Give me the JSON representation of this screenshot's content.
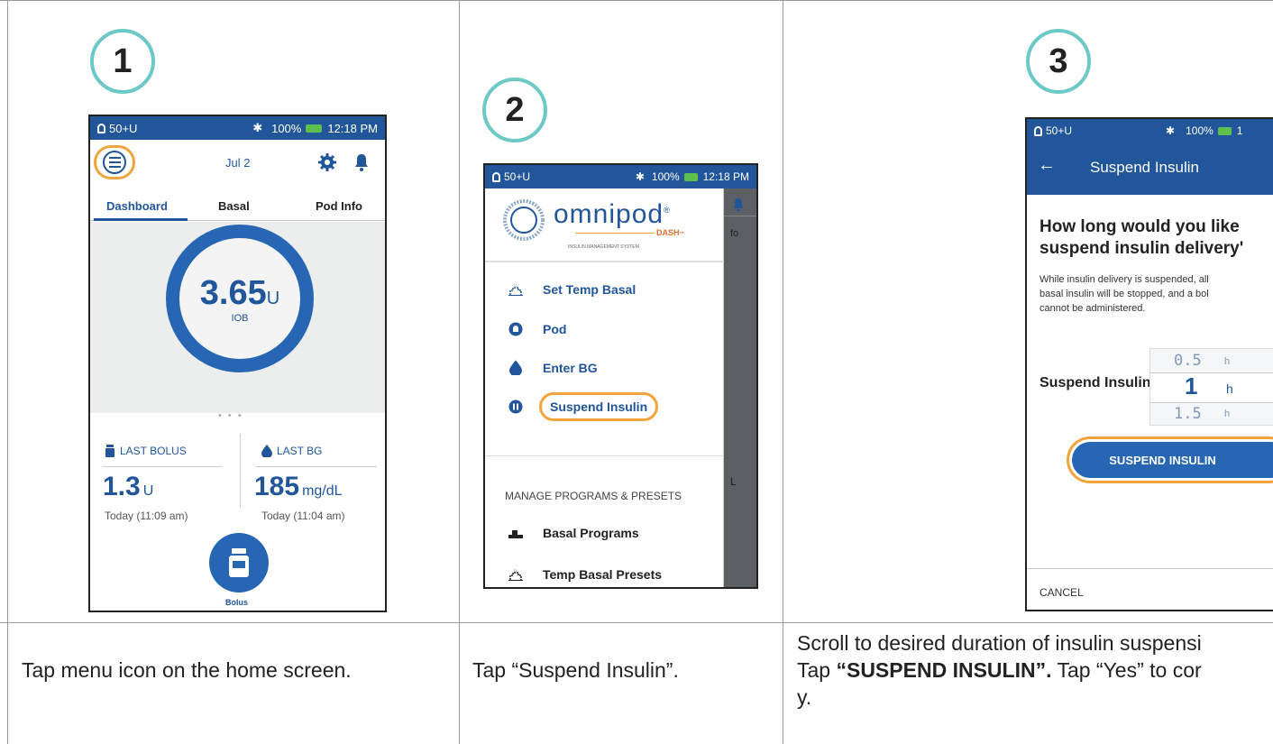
{
  "steps": [
    {
      "number": "1",
      "caption": "Tap menu icon on the home screen."
    },
    {
      "number": "2",
      "caption": "Tap “Suspend Insulin”."
    },
    {
      "number": "3",
      "caption_lines": [
        "Scroll to desired duration of insulin suspensi",
        "Tap ",
        "“SUSPEND INSULIN”.",
        " Tap “Yes” to cor",
        "y."
      ]
    }
  ],
  "status_bar": {
    "left": "50+U",
    "bt": "✱",
    "battery": "100%",
    "time": "12:18 PM",
    "time_cut": "1"
  },
  "screen1": {
    "date": "Jul 2",
    "tabs": [
      "Dashboard",
      "Basal",
      "Pod Info"
    ],
    "iob_value": "3.65",
    "iob_unit": "U",
    "iob_label": "IOB",
    "dots": "• • •",
    "last_bolus_label": "LAST BOLUS",
    "last_bolus_value": "1.3",
    "last_bolus_unit": "U",
    "last_bolus_time": "Today (11:09 am)",
    "last_bg_label": "LAST BG",
    "last_bg_value": "185",
    "last_bg_unit": "mg/dL",
    "last_bg_time": "Today (11:04 am)",
    "bolus_label": "Bolus"
  },
  "screen2": {
    "brand": "omnipod",
    "brand_reg": "®",
    "brand_sub": "DASH",
    "brand_tm": "™",
    "brand_tag": "INSULIN MANAGEMENT SYSTEM",
    "menu": [
      "Set Temp Basal",
      "Pod",
      "Enter BG",
      "Suspend Insulin"
    ],
    "section_title": "MANAGE PROGRAMS & PRESETS",
    "menu2": [
      "Basal Programs",
      "Temp Basal Presets"
    ],
    "behind_text_1": "fo",
    "behind_text_2": "L"
  },
  "screen3": {
    "title": "Suspend Insulin",
    "back": "←",
    "heading_1": "How long would you like",
    "heading_2": "suspend insulin delivery'",
    "body_1": "While insulin delivery is suspended, all",
    "body_2": "basal insulin will be stopped, and a bol",
    "body_3": "cannot be administered.",
    "picker_label": "Suspend Insulin f",
    "picker_values": [
      "0.5",
      "1",
      "1.5"
    ],
    "picker_unit": "h",
    "button": "SUSPEND INSULIN",
    "cancel": "CANCEL"
  },
  "colors": {
    "brand_blue": "#21569a",
    "highlight_orange": "#f1a43a",
    "step_teal": "#6cc9c5"
  }
}
